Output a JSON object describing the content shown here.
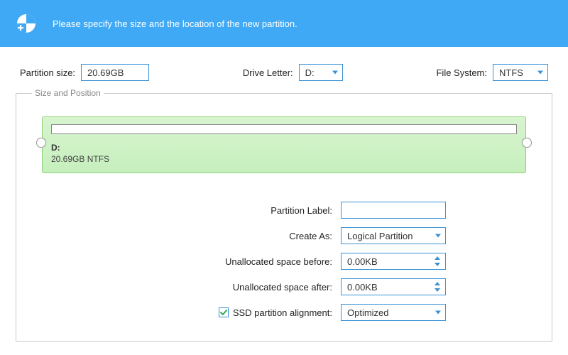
{
  "header": {
    "headline": "Please specify the size and the location of the new partition."
  },
  "top": {
    "partition_size_label": "Partition size:",
    "partition_size_value": "20.69GB",
    "drive_letter_label": "Drive Letter:",
    "drive_letter_value": "D:",
    "file_system_label": "File System:",
    "file_system_value": "NTFS"
  },
  "fieldset": {
    "legend": "Size and Position",
    "visual": {
      "title": "D:",
      "subtitle": "20.69GB NTFS"
    },
    "form": {
      "partition_label_label": "Partition Label:",
      "partition_label_value": "",
      "create_as_label": "Create As:",
      "create_as_value": "Logical Partition",
      "unalloc_before_label": "Unallocated space before:",
      "unalloc_before_value": "0.00KB",
      "unalloc_after_label": "Unallocated space after:",
      "unalloc_after_value": "0.00KB",
      "ssd_checked": true,
      "ssd_label": "SSD partition alignment:",
      "ssd_value": "Optimized"
    }
  },
  "colors": {
    "accent": "#3a92d6",
    "header_bg": "#3fa9f5",
    "partition_fill": "#c9efbf",
    "partition_border": "#8fd27a",
    "check_green": "#2fae57"
  }
}
